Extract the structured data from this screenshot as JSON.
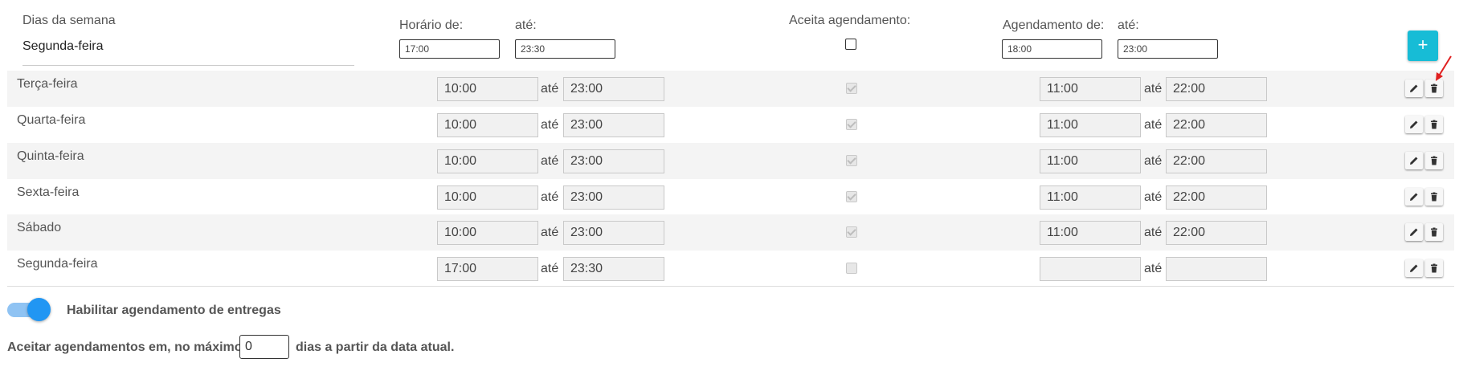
{
  "header": {
    "days_label": "Dias da semana",
    "selected_day": "Segunda-feira",
    "hours_from_label": "Horário de:",
    "hours_to_label": "até:",
    "from_value": "17:00",
    "to_value": "23:30",
    "accepts_label": "Aceita agendamento:",
    "accepts_checked": false,
    "schedule_from_label": "Agendamento de:",
    "schedule_to_label": "até:",
    "schedule_from_value": "18:00",
    "schedule_to_value": "23:00",
    "add_label": "+"
  },
  "rows": [
    {
      "day": "Terça-feira",
      "from": "10:00",
      "ate": "até",
      "to": "23:00",
      "accepts": true,
      "sched_from": "11:00",
      "ate2": "até",
      "sched_to": "22:00"
    },
    {
      "day": "Quarta-feira",
      "from": "10:00",
      "ate": "até",
      "to": "23:00",
      "accepts": true,
      "sched_from": "11:00",
      "ate2": "até",
      "sched_to": "22:00"
    },
    {
      "day": "Quinta-feira",
      "from": "10:00",
      "ate": "até",
      "to": "23:00",
      "accepts": true,
      "sched_from": "11:00",
      "ate2": "até",
      "sched_to": "22:00"
    },
    {
      "day": "Sexta-feira",
      "from": "10:00",
      "ate": "até",
      "to": "23:00",
      "accepts": true,
      "sched_from": "11:00",
      "ate2": "até",
      "sched_to": "22:00"
    },
    {
      "day": "Sábado",
      "from": "10:00",
      "ate": "até",
      "to": "23:00",
      "accepts": true,
      "sched_from": "11:00",
      "ate2": "até",
      "sched_to": "22:00"
    },
    {
      "day": "Segunda-feira",
      "from": "17:00",
      "ate": "até",
      "to": "23:30",
      "accepts": false,
      "sched_from": "",
      "ate2": "até",
      "sched_to": ""
    }
  ],
  "footer": {
    "toggle_label": "Habilitar agendamento de entregas",
    "toggle_on": true,
    "max_prefix": "Aceitar agendamentos em, no máximo",
    "max_value": "0",
    "max_suffix": "dias a partir da data atual."
  },
  "colors": {
    "accent": "#17bcd6",
    "toggle": "#2196f3",
    "annotation_arrow": "#e02020"
  }
}
